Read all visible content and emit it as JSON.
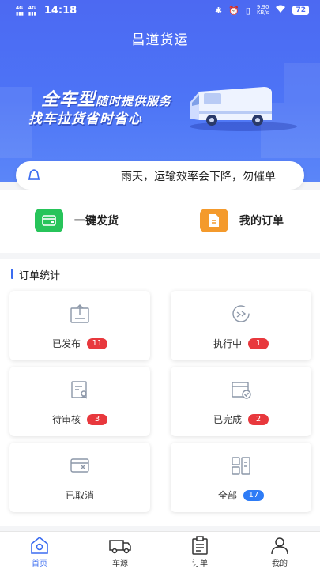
{
  "status_bar": {
    "network_left": "4G",
    "network_right": "4G",
    "time": "14:18",
    "speed_value": "9.90",
    "speed_unit": "KB/s",
    "battery": "72"
  },
  "header": {
    "title": "昌道货运"
  },
  "banner": {
    "line1_highlight": "全车型",
    "line1_rest": "随时提供服务",
    "line2": "找车拉货省时省心"
  },
  "notice": {
    "text": "雨天，运输效率会下降，勿催单"
  },
  "quick_actions": [
    {
      "label": "一键发货",
      "color": "#27c45a",
      "icon": "ship-icon"
    },
    {
      "label": "我的订单",
      "color": "#f49a2c",
      "icon": "order-doc-icon"
    }
  ],
  "stats": {
    "title": "订单统计",
    "cards": [
      {
        "label": "已发布",
        "count": "11",
        "badge": "red"
      },
      {
        "label": "执行中",
        "count": "1",
        "badge": "red"
      },
      {
        "label": "待审核",
        "count": "3",
        "badge": "red"
      },
      {
        "label": "已完成",
        "count": "2",
        "badge": "red"
      },
      {
        "label": "已取消",
        "count": "",
        "badge": "none"
      },
      {
        "label": "全部",
        "count": "17",
        "badge": "blue"
      }
    ]
  },
  "tabbar": {
    "items": [
      {
        "label": "首页",
        "active": true
      },
      {
        "label": "车源",
        "active": false
      },
      {
        "label": "订单",
        "active": false
      },
      {
        "label": "我的",
        "active": false
      }
    ]
  },
  "colors": {
    "primary": "#4c69f2",
    "accent_blue": "#3b6cf0",
    "badge_red": "#e8383d",
    "badge_blue": "#2e7cf6"
  }
}
